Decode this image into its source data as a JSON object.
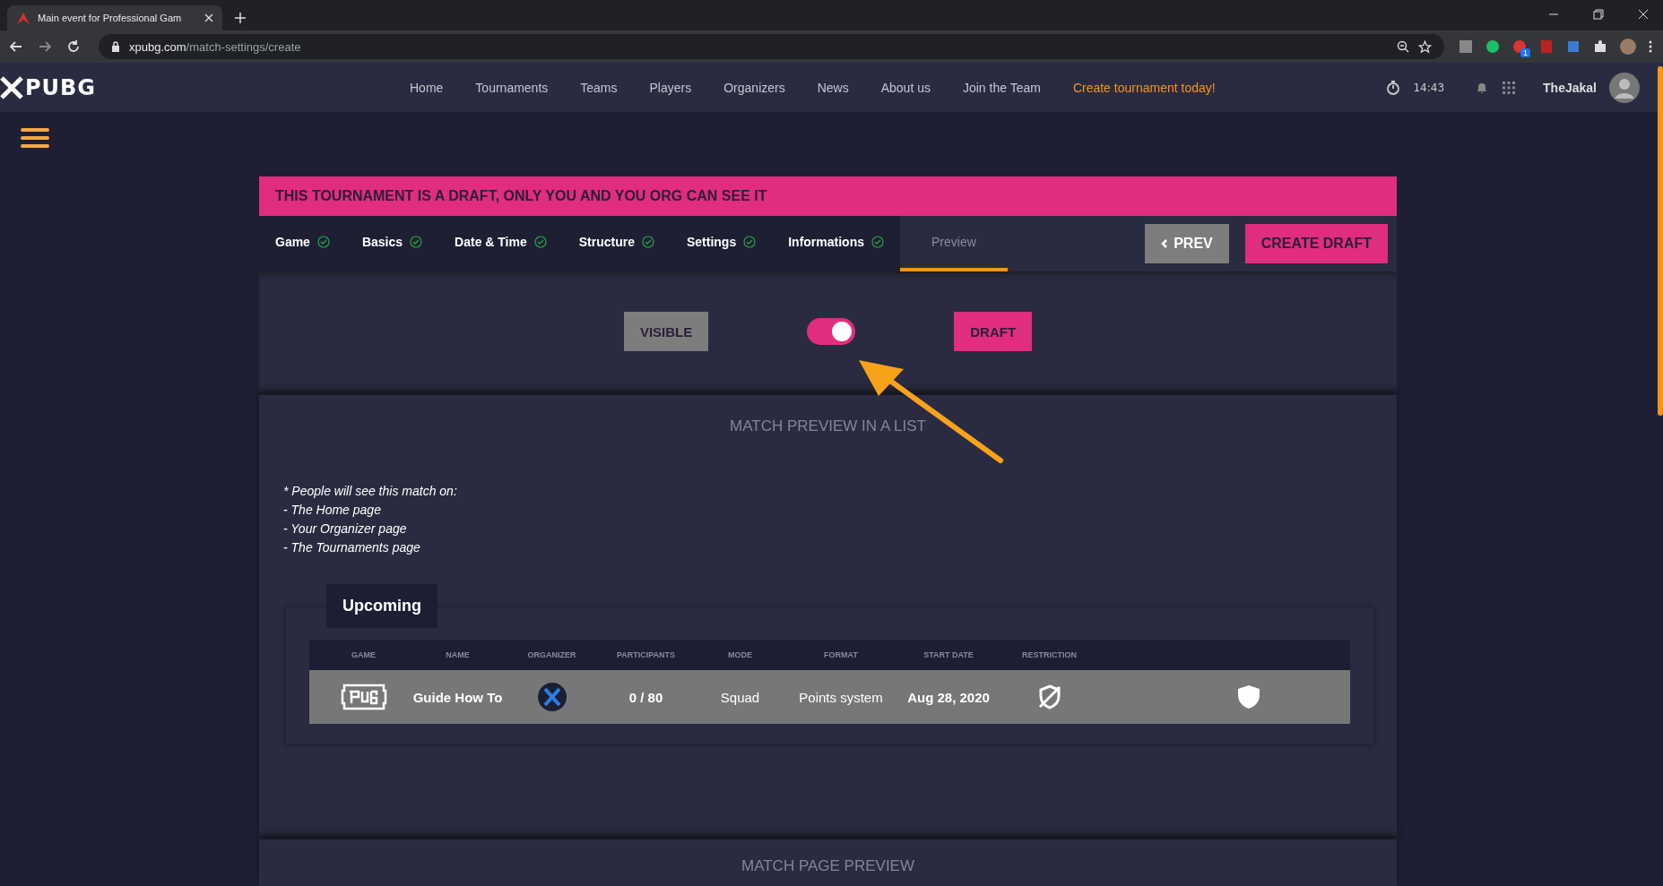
{
  "browser": {
    "tab_title": "Main event for Professional Gam",
    "url_domain": "xpubg.com",
    "url_path": "/match-settings/create",
    "extension_badge": "1"
  },
  "site_nav": {
    "logo": "PUBG",
    "links": [
      {
        "label": "Home",
        "highlight": false
      },
      {
        "label": "Tournaments",
        "highlight": false
      },
      {
        "label": "Teams",
        "highlight": false
      },
      {
        "label": "Players",
        "highlight": false
      },
      {
        "label": "Organizers",
        "highlight": false
      },
      {
        "label": "News",
        "highlight": false
      },
      {
        "label": "About us",
        "highlight": false
      },
      {
        "label": "Join the Team",
        "highlight": false
      },
      {
        "label": "Create tournament today!",
        "highlight": true
      }
    ],
    "time": "14:43",
    "username": "TheJakal"
  },
  "banner": "THIS TOURNAMENT IS A DRAFT, ONLY YOU AND YOU ORG CAN SEE IT",
  "steps": [
    {
      "label": "Game",
      "done": true,
      "selected": false
    },
    {
      "label": "Basics",
      "done": true,
      "selected": false
    },
    {
      "label": "Date & Time",
      "done": true,
      "selected": false
    },
    {
      "label": "Structure",
      "done": true,
      "selected": false
    },
    {
      "label": "Settings",
      "done": true,
      "selected": false
    },
    {
      "label": "Informations",
      "done": true,
      "selected": false
    },
    {
      "label": "Preview",
      "done": false,
      "selected": true
    }
  ],
  "prev_button": "PREV",
  "create_button": "CREATE DRAFT",
  "visibility": {
    "left_label": "VISIBLE",
    "right_label": "DRAFT",
    "on": true
  },
  "list_preview": {
    "heading": "MATCH PREVIEW IN A LIST",
    "notes": [
      "* People will see this match on:",
      "- The Home page",
      "- Your Organizer page",
      "- The Tournaments page"
    ],
    "tab": "Upcoming",
    "columns": [
      "GAME",
      "NAME",
      "ORGANIZER",
      "PARTICIPANTS",
      "MODE",
      "FORMAT",
      "START DATE",
      "RESTRICTION"
    ],
    "row": {
      "name": "Guide How To",
      "participants": "0 / 80",
      "mode": "Squad",
      "format": "Points system",
      "start_date": "Aug 28, 2020"
    }
  },
  "page_preview": {
    "heading": "MATCH PAGE PREVIEW"
  }
}
